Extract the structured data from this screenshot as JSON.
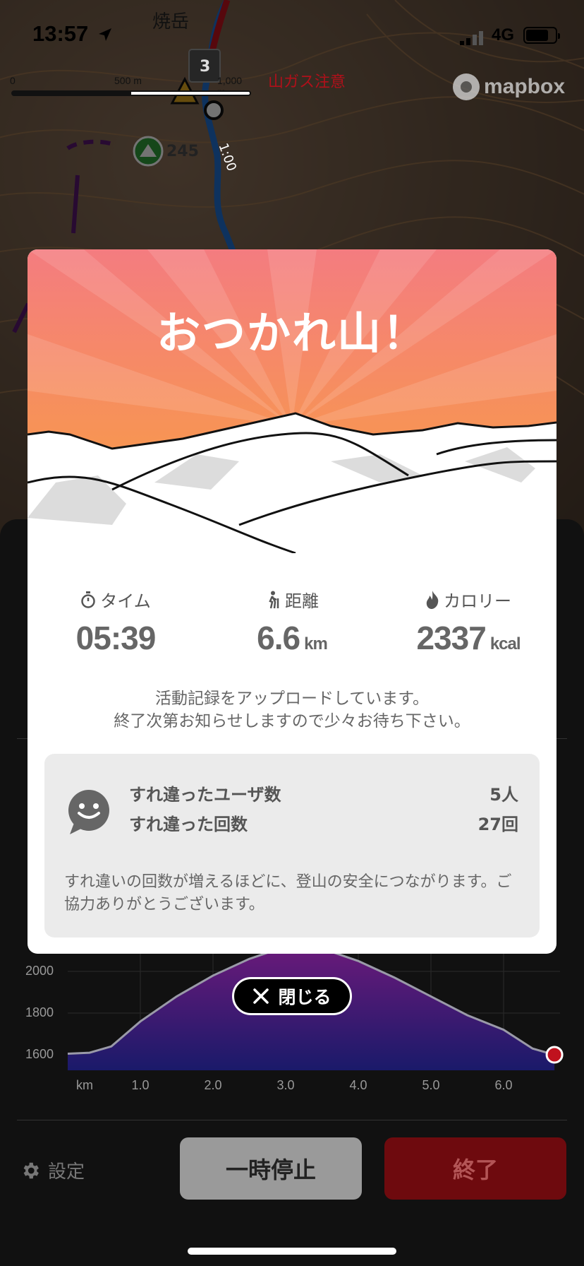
{
  "status_bar": {
    "time": "13:57",
    "network": "4G"
  },
  "map": {
    "scale": {
      "zero": "0",
      "mid": "500 m",
      "max": "1,000 m"
    },
    "attribution": "mapbox",
    "peak_name": "焼岳",
    "warning": "山ガス注意",
    "waypoint_number": "3",
    "elevation_label": "245",
    "segment_time": "1:00"
  },
  "modal": {
    "title": "おつかれ山！",
    "stats": [
      {
        "icon": "stopwatch-icon",
        "label": "タイム",
        "value": "05:39",
        "unit": ""
      },
      {
        "icon": "hiker-icon",
        "label": "距離",
        "value": "6.6",
        "unit": "km"
      },
      {
        "icon": "flame-icon",
        "label": "カロリー",
        "value": "2337",
        "unit": "kcal"
      }
    ],
    "upload_message_line1": "活動記録をアップロードしています。",
    "upload_message_line2": "終了次第お知らせしますので少々お待ち下さい。",
    "passing": {
      "users_label": "すれ違ったユーザ数",
      "users_value": "5人",
      "count_label": "すれ違った回数",
      "count_value": "27回",
      "note": "すれ違いの回数が増えるほどに、登山の安全につながります。ご協力ありがとうございます。"
    }
  },
  "close_button": {
    "label": "閉じる"
  },
  "chart_data": {
    "type": "area",
    "title": "",
    "xlabel": "km",
    "ylabel": "",
    "x_ticks": [
      "1.0",
      "2.0",
      "3.0",
      "4.0",
      "5.0",
      "6.0"
    ],
    "y_ticks": [
      "1600",
      "1800",
      "2000"
    ],
    "series": [
      {
        "x": [
          0.0,
          0.3,
          0.6,
          1.0,
          1.5,
          2.0,
          2.5,
          3.0,
          3.5,
          4.0,
          4.5,
          5.0,
          5.5,
          6.0,
          6.4,
          6.7
        ],
        "y": [
          1605,
          1610,
          1640,
          1760,
          1880,
          1980,
          2060,
          2120,
          2110,
          2050,
          1970,
          1880,
          1790,
          1720,
          1630,
          1600
        ]
      }
    ],
    "current_position_km": 6.7
  },
  "controls": {
    "settings_label": "設定",
    "pause_label": "一時停止",
    "end_label": "終了"
  },
  "colors": {
    "hero_top": "#f47c80",
    "hero_bottom": "#f9a23b",
    "end_button": "#6e0a0e",
    "track_blue": "#1f6fd0",
    "track_red": "#c0121e"
  }
}
